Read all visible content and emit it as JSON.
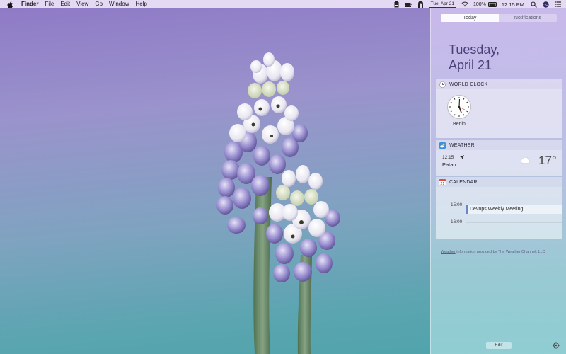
{
  "menubar": {
    "app_name": "Finder",
    "menus": [
      "File",
      "Edit",
      "View",
      "Go",
      "Window",
      "Help"
    ],
    "date_badge": "Tue, Apr 21",
    "battery": "100%",
    "time": "12:15 PM",
    "icons": [
      "apple-icon",
      "clipboard-icon",
      "coffee-icon",
      "app-icon",
      "wifi-icon",
      "battery-icon",
      "search-icon",
      "siri-icon",
      "notification-center-icon"
    ]
  },
  "notification_center": {
    "tabs": [
      {
        "label": "Today",
        "active": true
      },
      {
        "label": "Notifications",
        "active": false
      }
    ],
    "date_line1": "Tuesday,",
    "date_line2": "April 21",
    "world_clock": {
      "title": "WORLD CLOCK",
      "city": "Berlin"
    },
    "weather": {
      "title": "WEATHER",
      "time": "12:15",
      "city": "Patan",
      "temperature": "17°",
      "condition_icon": "cloud-icon"
    },
    "calendar": {
      "title": "CALENDAR",
      "rows": [
        {
          "time": "15:00",
          "event": "Devops Weekly Meeting"
        },
        {
          "time": "16:00",
          "event": ""
        }
      ]
    },
    "footnote_link": "Weather",
    "footnote_text": " information provided by The Weather Channel, LLC",
    "edit_label": "Edit"
  },
  "colors": {
    "accent_date": "#4a3f78",
    "calendar_event_bar": "#6b85c9"
  }
}
